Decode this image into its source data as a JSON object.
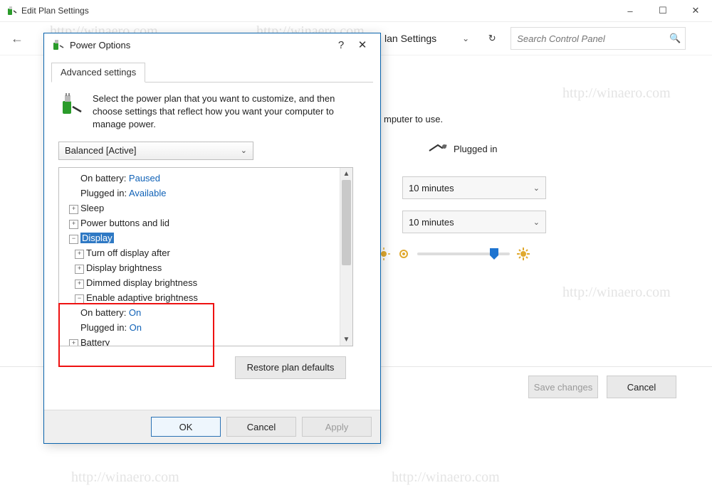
{
  "window": {
    "title": "Edit Plan Settings",
    "minimize": "–",
    "maximize": "☐",
    "close": "✕"
  },
  "toolbar": {
    "crumb_visible": "lan Settings",
    "refresh_glyph": "↻",
    "search_placeholder": "Search Control Panel"
  },
  "bg": {
    "computer_text": "mputer to use.",
    "plugged_in": "Plugged in",
    "dropdown1": "10 minutes",
    "dropdown2": "10 minutes",
    "save": "Save changes",
    "cancel": "Cancel"
  },
  "dialog": {
    "title": "Power Options",
    "help": "?",
    "close": "✕",
    "tab": "Advanced settings",
    "intro": "Select the power plan that you want to customize, and then choose settings that reflect how you want your computer to manage power.",
    "plan": "Balanced [Active]",
    "restore": "Restore plan defaults",
    "ok": "OK",
    "cancel": "Cancel",
    "apply": "Apply"
  },
  "tree": {
    "r1_label": "On battery: ",
    "r1_value": "Paused",
    "r2_label": "Plugged in: ",
    "r2_value": "Available",
    "r3": "Sleep",
    "r4": "Power buttons and lid",
    "r5": "Display",
    "r6": "Turn off display after",
    "r7": "Display brightness",
    "r8": "Dimmed display brightness",
    "r9": "Enable adaptive brightness",
    "r10_label": "On battery: ",
    "r10_value": "On",
    "r11_label": "Plugged in: ",
    "r11_value": "On",
    "r12": "Battery"
  },
  "watermarks": {
    "w": "http://winaero.com"
  }
}
